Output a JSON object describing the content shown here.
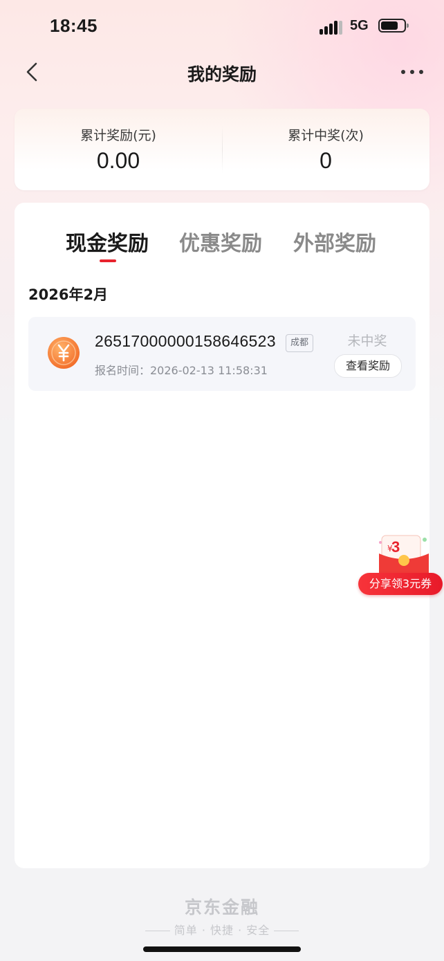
{
  "status_bar": {
    "time": "18:45",
    "network": "5G"
  },
  "nav": {
    "title": "我的奖励",
    "back_icon": "chevron-left-icon",
    "more_icon": "more-dots-icon"
  },
  "summary": {
    "total_reward_label": "累计奖励(元)",
    "total_reward_value": "0.00",
    "total_wins_label": "累计中奖(次)",
    "total_wins_value": "0"
  },
  "tabs": [
    {
      "label": "现金奖励",
      "active": true
    },
    {
      "label": "优惠奖励",
      "active": false
    },
    {
      "label": "外部奖励",
      "active": false
    }
  ],
  "records": {
    "month": "2026年2月",
    "items": [
      {
        "id": "26517000000158646523",
        "city": "成都",
        "time": "报名时间：2026-02-13 11:58:31",
        "status": "未中奖",
        "action": "查看奖励",
        "icon": "yuan-coin-icon"
      }
    ]
  },
  "share": {
    "currency": "¥",
    "amount": "3",
    "label": "分享领3元券"
  },
  "footer": {
    "brand": "京东金融",
    "slogan": "简单 · 快捷 · 安全"
  },
  "colors": {
    "accent": "#e8232d",
    "muted": "#8a8a8a",
    "card": "#ffffff",
    "record_bg": "#f5f6fa"
  }
}
